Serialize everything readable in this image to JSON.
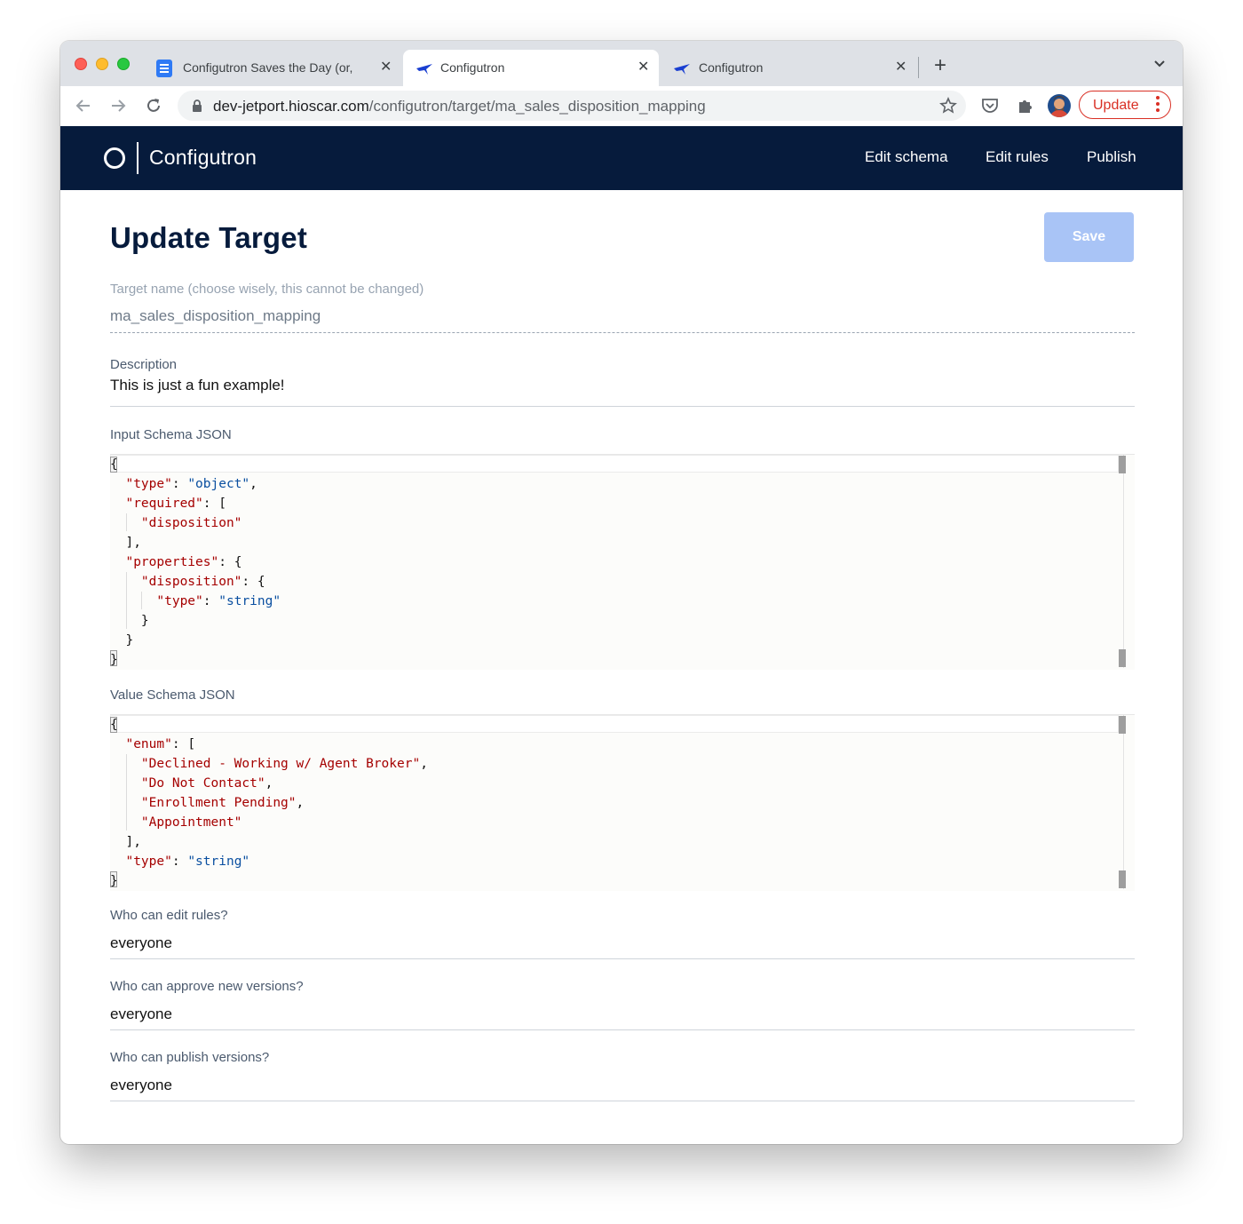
{
  "browser": {
    "tabs": [
      {
        "title": "Configutron Saves the Day (or,",
        "icon": "google-docs-icon",
        "active": false
      },
      {
        "title": "Configutron",
        "icon": "plane-icon",
        "active": true
      },
      {
        "title": "Configutron",
        "icon": "plane-icon",
        "active": false
      }
    ],
    "url_host": "dev-jetport.hioscar.com",
    "url_path": "/configutron/target/ma_sales_disposition_mapping",
    "update_label": "Update",
    "update_color": "#d93025"
  },
  "app": {
    "name": "Configutron",
    "nav": [
      "Edit schema",
      "Edit rules",
      "Publish"
    ],
    "header_color": "#061b3c"
  },
  "page": {
    "title": "Update Target",
    "save_label": "Save",
    "target_name_label": "Target name (choose wisely, this cannot be changed)",
    "target_name_value": "ma_sales_disposition_mapping",
    "description_label": "Description",
    "description_value": "This is just a fun example!",
    "input_schema_label": "Input Schema JSON",
    "value_schema_label": "Value Schema JSON",
    "edit_rules_label": "Who can edit rules?",
    "edit_rules_value": "everyone",
    "approve_label": "Who can approve new versions?",
    "approve_value": "everyone",
    "publish_label": "Who can publish versions?",
    "publish_value": "everyone"
  },
  "input_schema_lines": [
    "{",
    "  \"type\": \"object\",",
    "  \"required\": [",
    "    \"disposition\"",
    "  ],",
    "  \"properties\": {",
    "    \"disposition\": {",
    "      \"type\": \"string\"",
    "    }",
    "  }",
    "}"
  ],
  "value_schema_lines": [
    "{",
    "  \"enum\": [",
    "    \"Declined - Working w/ Agent Broker\",",
    "    \"Do Not Contact\",",
    "    \"Enrollment Pending\",",
    "    \"Appointment\"",
    "  ],",
    "  \"type\": \"string\"",
    "}"
  ]
}
